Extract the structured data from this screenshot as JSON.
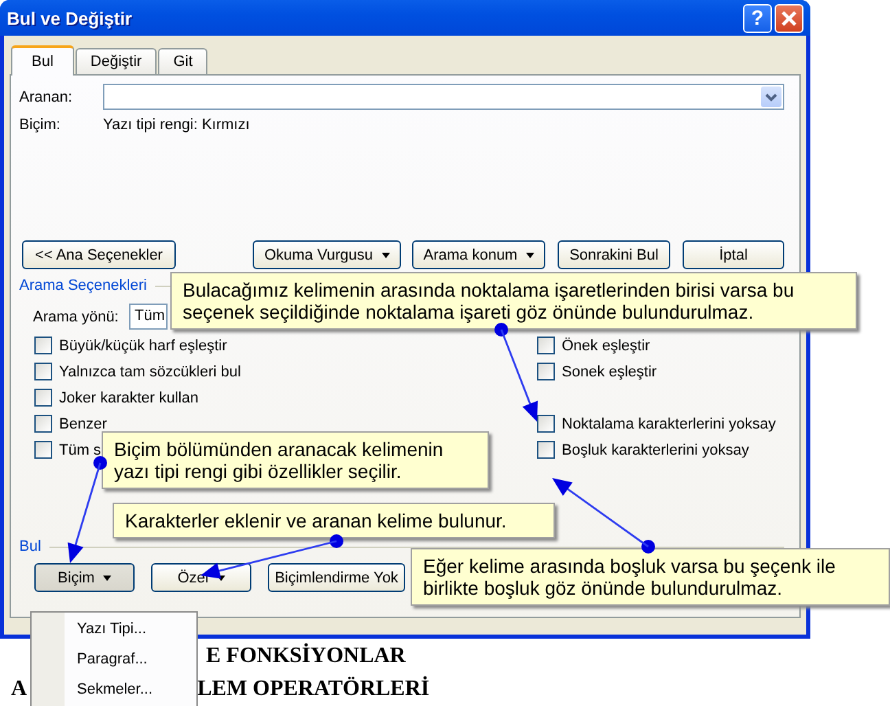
{
  "window": {
    "title": "Bul ve Değiştir",
    "help": "?"
  },
  "tabs": [
    {
      "label": "Bul",
      "selected": true
    },
    {
      "label": "Değiştir",
      "selected": false
    },
    {
      "label": "Git",
      "selected": false
    }
  ],
  "find": {
    "label": "Aranan:"
  },
  "format": {
    "label": "Biçim:",
    "value": "Yazı tipi rengi: Kırmızı"
  },
  "top_buttons": [
    {
      "label": "<< Ana Seçenekler",
      "kind": "button"
    },
    {
      "label": "Okuma Vurgusu",
      "kind": "dropdown"
    },
    {
      "label": "Arama konum",
      "kind": "dropdown"
    },
    {
      "label": "Sonrakini Bul",
      "kind": "button"
    },
    {
      "label": "İptal",
      "kind": "button"
    }
  ],
  "search_options": {
    "title": "Arama Seçenekleri",
    "direction_label": "Arama yönü:",
    "direction_value": "Tüm",
    "left_options": [
      {
        "label": "Büyük/küçük harf eşleştir",
        "checked": false
      },
      {
        "label": "Yalnızca tam sözcükleri bul",
        "checked": false
      },
      {
        "label": "Joker karakter kullan",
        "checked": false
      },
      {
        "label": "Benzer",
        "checked": false
      },
      {
        "label": "Tüm s",
        "checked": false
      }
    ],
    "right_options_top": [
      {
        "label": "Önek eşleştir",
        "checked": false
      },
      {
        "label": "Sonek eşleştir",
        "checked": false
      }
    ],
    "right_options_bottom": [
      {
        "label": "Noktalama karakterlerini yoksay",
        "checked": false
      },
      {
        "label": "Boşluk karakterlerini yoksay",
        "checked": false
      }
    ]
  },
  "find_section": {
    "title": "Bul",
    "buttons": [
      {
        "label": "Biçim",
        "kind": "dropdown",
        "pressed": true
      },
      {
        "label": "Özel",
        "kind": "dropdown",
        "pressed": false
      },
      {
        "label": "Biçimlendirme Yok",
        "kind": "button",
        "pressed": false
      }
    ]
  },
  "menu": {
    "items": [
      "Yazı Tipi...",
      "Paragraf...",
      "Sekmeler..."
    ]
  },
  "document": {
    "line_1": "E FONKSİYONLAR",
    "line_2_start": "A",
    "line_2_end": "LEM OPERATÖRLERİ"
  },
  "callouts": [
    {
      "text": "Bulacağımız kelimenin arasında noktalama işaretlerinden birisi varsa bu seçenek seçildiğinde noktalama işareti göz önünde bulundurulmaz."
    },
    {
      "text": "Biçim bölümünden aranacak kelimenin yazı tipi rengi gibi özellikler seçilir."
    },
    {
      "text": "Karakterler eklenir ve aranan kelime bulunur."
    },
    {
      "text": "Eğer kelime arasında boşluk varsa bu şeçenk ile birlikte boşluk göz önünde bulundurulmaz."
    }
  ]
}
